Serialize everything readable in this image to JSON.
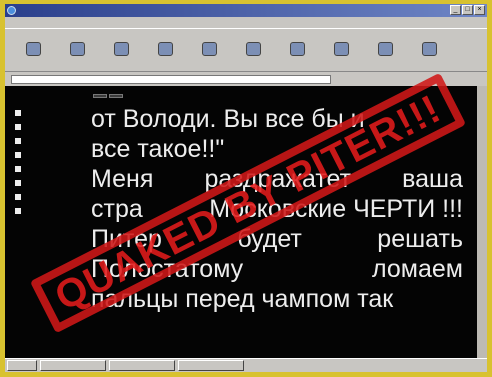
{
  "content": {
    "lines": [
      {
        "words": [
          "от Володи. Вы все бы и"
        ]
      },
      {
        "words": [
          "все такое!!\""
        ]
      },
      {
        "words": [
          "Меня",
          "раздражатет",
          "ваша"
        ]
      },
      {
        "words": [
          "стра",
          "Московские ЧЕРТИ !!!"
        ]
      },
      {
        "words": [
          "Питер",
          "будет",
          "решать"
        ]
      },
      {
        "words": [
          "Полостатому",
          "ломаем"
        ]
      },
      {
        "words": [
          "пальцы перед чампом так"
        ]
      }
    ]
  },
  "stamp": {
    "text": "QUAKED BY PITER!!!",
    "color": "#e31b1b"
  },
  "colors": {
    "frame": "#d8c230",
    "page_background": "#040404",
    "titlebar": "#2a3f8c"
  }
}
